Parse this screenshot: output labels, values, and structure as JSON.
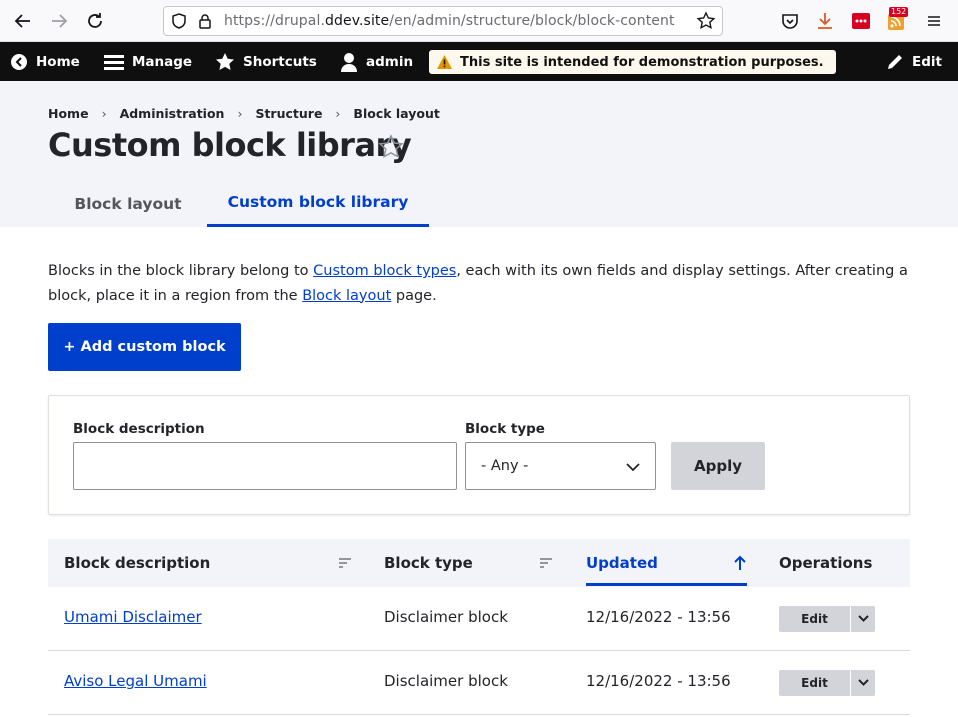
{
  "browser": {
    "url_prefix": "https://drupal.",
    "url_host": "ddev.site",
    "url_path": "/en/admin/structure/block/block-content",
    "notification_count": "152"
  },
  "toolbar": {
    "home": "Home",
    "manage": "Manage",
    "shortcuts": "Shortcuts",
    "user": "admin",
    "notice": "This site is intended for demonstration purposes.",
    "edit": "Edit"
  },
  "breadcrumb": [
    "Home",
    "Administration",
    "Structure",
    "Block layout"
  ],
  "page_title": "Custom block library",
  "tabs": [
    {
      "label": "Block layout",
      "active": false
    },
    {
      "label": "Custom block library",
      "active": true
    }
  ],
  "intro": {
    "part1": "Blocks in the block library belong to ",
    "link1": "Custom block types",
    "part2": ", each with its own fields and display settings. After creating a block, place it in a region from the ",
    "link2": "Block layout",
    "part3": " page."
  },
  "add_button": "+ Add custom block",
  "filters": {
    "description_label": "Block description",
    "description_value": "",
    "type_label": "Block type",
    "type_selected": "- Any -",
    "apply_label": "Apply"
  },
  "table": {
    "columns": [
      "Block description",
      "Block type",
      "Updated",
      "Operations"
    ],
    "sorted_column": "Updated",
    "rows": [
      {
        "description": "Umami Disclaimer",
        "type": "Disclaimer block",
        "updated": "12/16/2022 - 13:56",
        "op": "Edit"
      },
      {
        "description": "Aviso Legal Umami",
        "type": "Disclaimer block",
        "updated": "12/16/2022 - 13:56",
        "op": "Edit"
      }
    ]
  },
  "colors": {
    "accent": "#003ecc",
    "toolbar_bg": "#0f0f0f",
    "header_bg": "#f3f4f9"
  }
}
